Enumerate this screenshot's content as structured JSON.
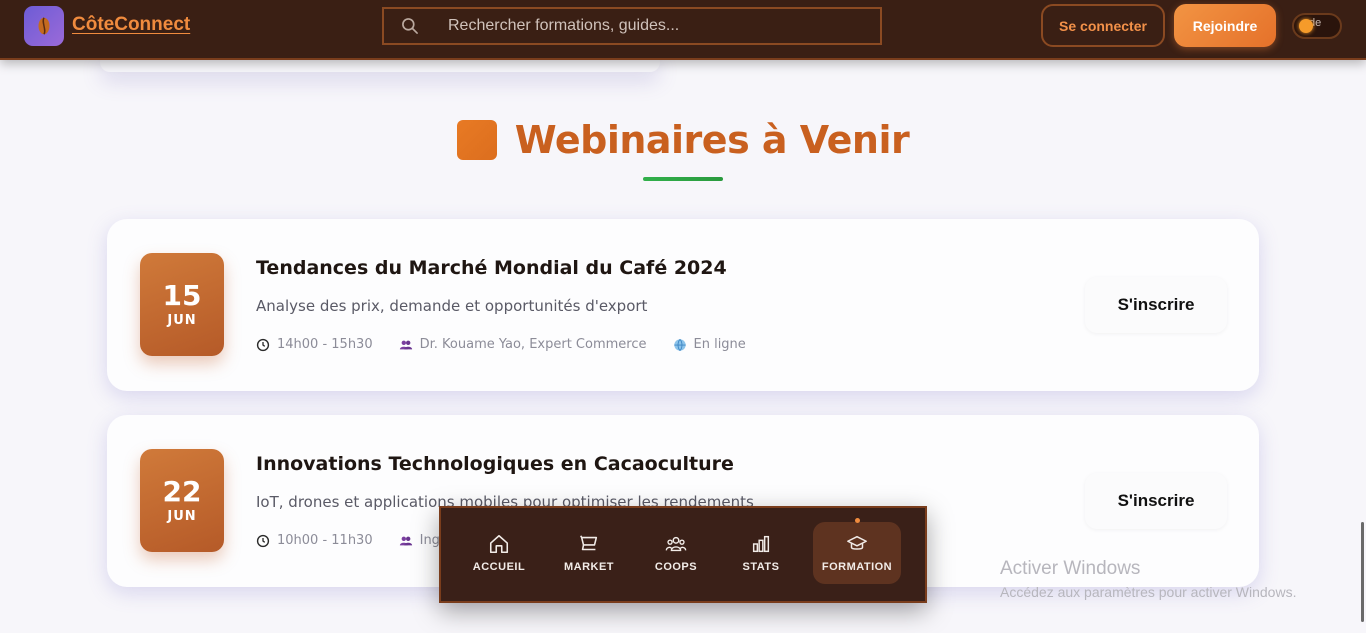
{
  "header": {
    "brand": "CôteConnect",
    "search_placeholder": "Rechercher formations, guides...",
    "login_label": "Se connecter",
    "join_label": "Rejoindre",
    "mode_label": "de"
  },
  "section": {
    "title": "Webinaires à Venir"
  },
  "webinars": [
    {
      "day": "15",
      "month": "JUN",
      "title": "Tendances du Marché Mondial du Café 2024",
      "description": "Analyse des prix, demande et opportunités d'export",
      "time": "14h00 - 15h30",
      "speaker": "Dr. Kouame Yao, Expert Commerce",
      "location": "En ligne",
      "register_label": "S'inscrire"
    },
    {
      "day": "22",
      "month": "JUN",
      "title": "Innovations Technologiques en Cacaoculture",
      "description": "IoT, drones et applications mobiles pour optimiser les rendements",
      "time": "10h00 - 11h30",
      "speaker": "Ing",
      "register_label": "S'inscrire"
    }
  ],
  "bottom_nav": {
    "items": [
      {
        "label": "ACCUEIL",
        "icon": "home-icon"
      },
      {
        "label": "MARKET",
        "icon": "cart-icon"
      },
      {
        "label": "COOPS",
        "icon": "users-icon"
      },
      {
        "label": "STATS",
        "icon": "bar-chart-icon"
      },
      {
        "label": "FORMATION",
        "icon": "graduation-cap-icon",
        "active": true
      }
    ]
  },
  "watermark": {
    "line1": "Activer Windows",
    "line2": "Accédez aux paramètres pour activer Windows."
  },
  "colors": {
    "header_bg": "#3a1f14",
    "accent_orange": "#f08b3e",
    "title_orange": "#c9601f",
    "green_underline": "#32b04b"
  }
}
